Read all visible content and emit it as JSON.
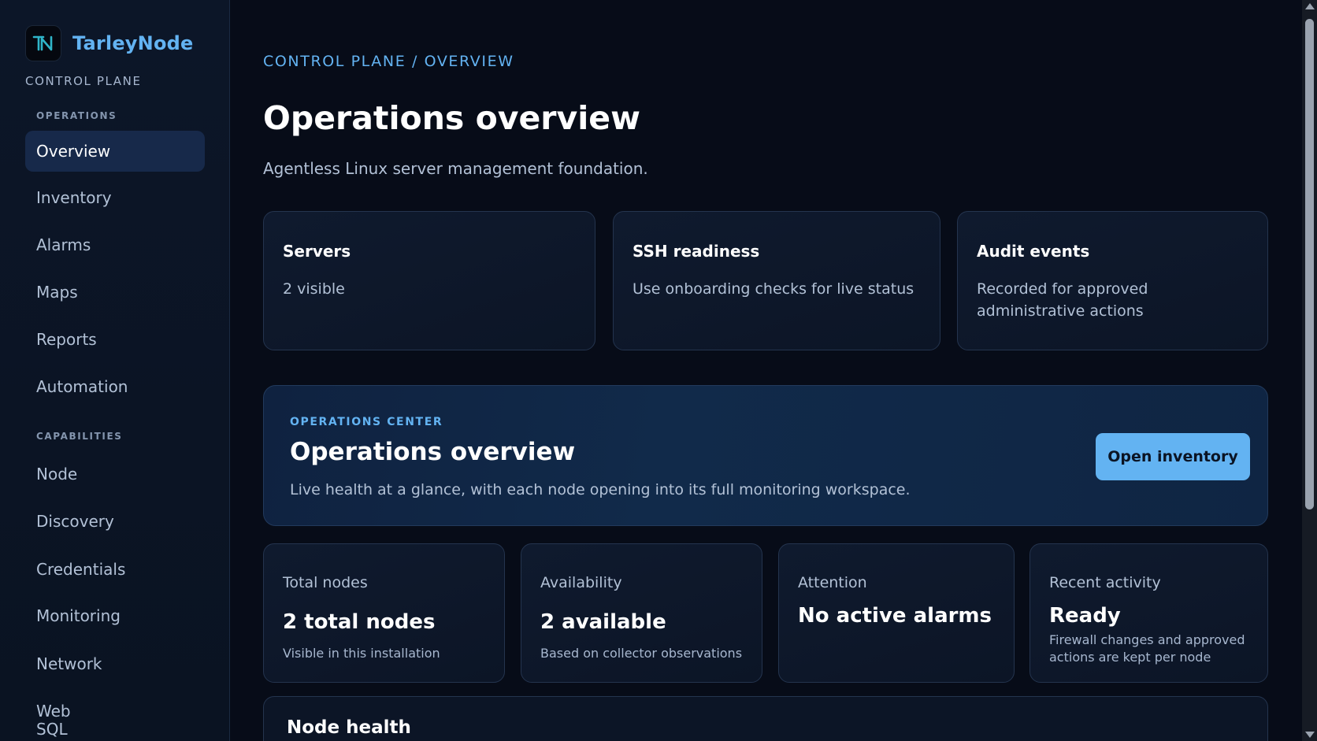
{
  "sidebar": {
    "brand": {
      "name": "TarleyNode",
      "subtitle": "CONTROL PLANE"
    },
    "sections": [
      {
        "label": "OPERATIONS",
        "items": [
          {
            "label": "Overview",
            "active": true
          },
          {
            "label": "Inventory"
          },
          {
            "label": "Alarms"
          },
          {
            "label": "Maps"
          },
          {
            "label": "Reports"
          },
          {
            "label": "Automation"
          }
        ]
      },
      {
        "label": "CAPABILITIES",
        "items": [
          {
            "label": "Node"
          },
          {
            "label": "Discovery"
          },
          {
            "label": "Credentials"
          },
          {
            "label": "Monitoring"
          },
          {
            "label": "Network"
          },
          {
            "label": "Web"
          },
          {
            "label": "SQL"
          }
        ]
      }
    ]
  },
  "header": {
    "breadcrumb": "CONTROL PLANE / OVERVIEW",
    "title": "Operations overview",
    "subtitle": "Agentless Linux server management foundation."
  },
  "summary_cards": [
    {
      "title": "Servers",
      "body": "2 visible"
    },
    {
      "title": "SSH readiness",
      "body": "Use onboarding checks for live status"
    },
    {
      "title": "Audit events",
      "body": "Recorded for approved administrative actions"
    }
  ],
  "hero": {
    "eyebrow": "OPERATIONS CENTER",
    "title": "Operations overview",
    "description": "Live health at a glance, with each node opening into its full monitoring workspace.",
    "button_label": "Open inventory"
  },
  "stats": [
    {
      "label": "Total nodes",
      "value": "2 total nodes",
      "note": "Visible in this installation"
    },
    {
      "label": "Availability",
      "value": "2 available",
      "note": "Based on collector observations"
    },
    {
      "label": "Attention",
      "value": "No active alarms",
      "note": ""
    },
    {
      "label": "Recent activity",
      "value": "Ready",
      "note": "Firewall changes and approved actions are kept per node"
    }
  ],
  "node_health": {
    "title": "Node health"
  },
  "colors": {
    "accent": "#63b3f2",
    "background": "#070c18",
    "sidebar": "#0c1628",
    "active_nav": "#17294a"
  }
}
